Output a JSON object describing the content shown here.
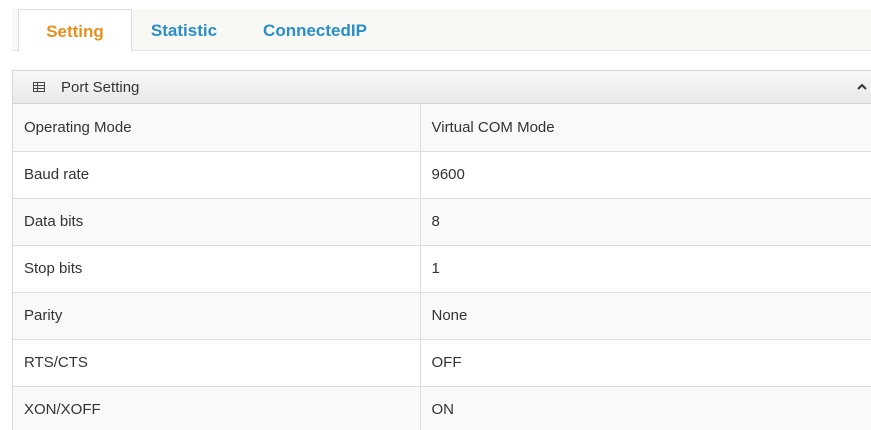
{
  "tabs": [
    {
      "label": "Setting",
      "active": true,
      "color": "#e8901e"
    },
    {
      "label": "Statistic",
      "active": false,
      "color": "#2a8fc8"
    },
    {
      "label": "ConnectedIP",
      "active": false,
      "color": "#2a8fc8"
    }
  ],
  "panel": {
    "title": "Port Setting",
    "icon": "table-grid-icon",
    "collapse_icon": "chevron-up-icon"
  },
  "settings": [
    {
      "label": "Operating Mode",
      "value": "Virtual COM Mode"
    },
    {
      "label": "Baud rate",
      "value": "9600"
    },
    {
      "label": "Data bits",
      "value": "8"
    },
    {
      "label": "Stop bits",
      "value": "1"
    },
    {
      "label": "Parity",
      "value": "None"
    },
    {
      "label": "RTS/CTS",
      "value": "OFF"
    },
    {
      "label": "XON/XOFF",
      "value": "ON"
    }
  ],
  "colors": {
    "active_tab": "#e8901e",
    "inactive_tab": "#2a8fc8",
    "text": "#333333"
  }
}
